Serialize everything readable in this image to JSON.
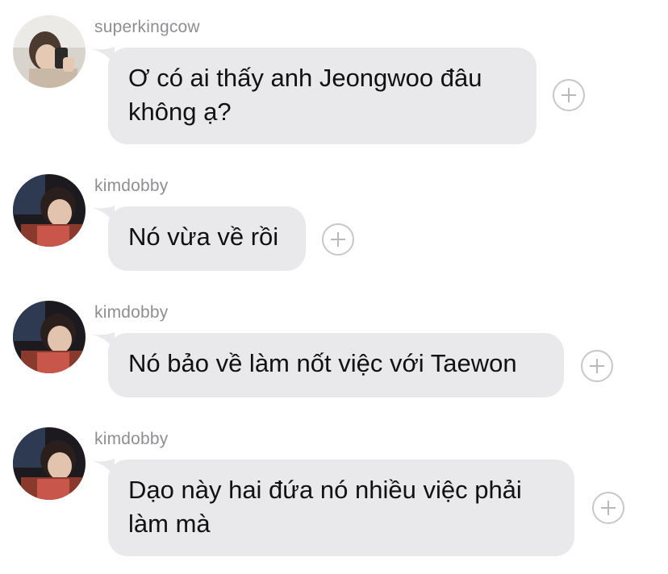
{
  "messages": [
    {
      "sender": "superkingcow",
      "text": "Ơ có ai thấy anh Jeongwoo đâu\nkhông ạ?",
      "avatar_icon": "user-avatar-superkingcow",
      "react_icon": "add-reaction-icon"
    },
    {
      "sender": "kimdobby",
      "text": "Nó vừa về rồi",
      "avatar_icon": "user-avatar-kimdobby",
      "react_icon": "add-reaction-icon"
    },
    {
      "sender": "kimdobby",
      "text": "Nó bảo về làm nốt việc với Taewon",
      "avatar_icon": "user-avatar-kimdobby",
      "react_icon": "add-reaction-icon"
    },
    {
      "sender": "kimdobby",
      "text": "Dạo này hai đứa nó nhiều việc phải\nlàm mà",
      "avatar_icon": "user-avatar-kimdobby",
      "react_icon": "add-reaction-icon"
    }
  ],
  "colors": {
    "bubble": "#e9e9eb",
    "username": "#8e8e93",
    "text": "#111111"
  }
}
